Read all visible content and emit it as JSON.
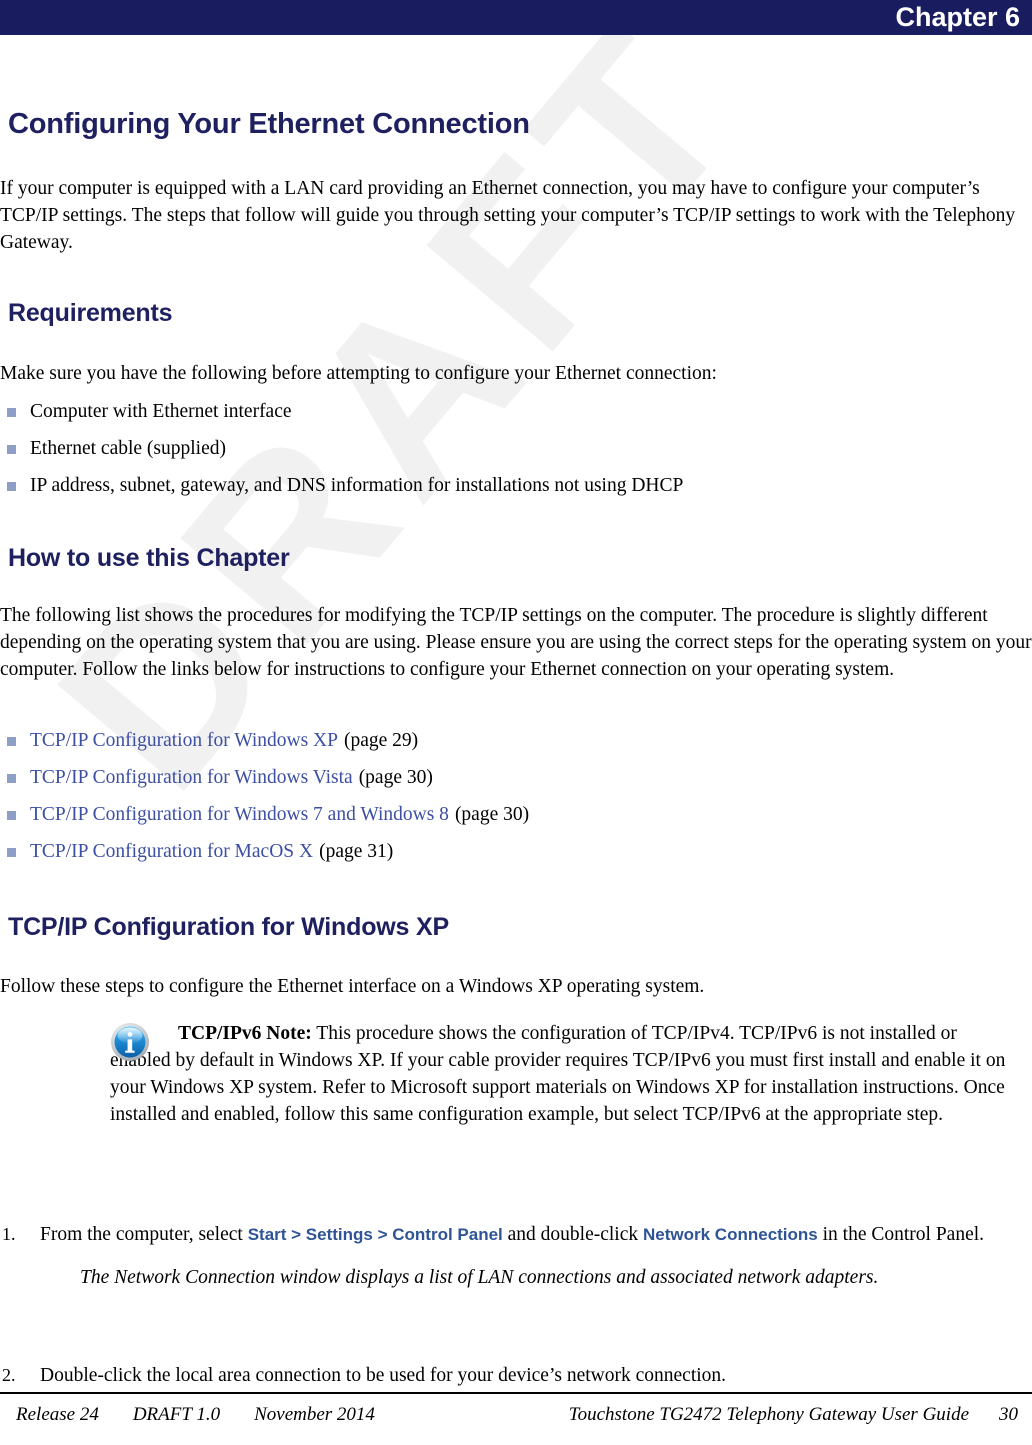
{
  "header": {
    "chapter_label": "Chapter 6",
    "bar_color": "#191c5e"
  },
  "watermark": {
    "text": "DRAFT",
    "color": "#f1f1f1"
  },
  "colors": {
    "heading": "#1e2060",
    "link": "#3c4fa3",
    "ui_object": "#2e5496",
    "bullet": "#8e9ec7"
  },
  "sections": {
    "main_heading": "Configuring Your Ethernet Connection",
    "intro_paragraph": "If your computer is equipped with a LAN card providing an Ethernet connection, you may have to configure your computer’s TCP/IP settings. The steps that follow will guide you through setting your computer’s TCP/IP settings to work with the Telephony Gateway.",
    "requirements": {
      "heading": "Requirements",
      "lead_in": "Make sure you have the following before attempting to configure your Ethernet connection:",
      "items": [
        "Computer with Ethernet interface",
        "Ethernet cable (supplied)",
        "IP address, subnet, gateway, and DNS information for installations not using DHCP"
      ]
    },
    "how_to_use": {
      "heading": "How to use this Chapter",
      "paragraph": "The following list shows the procedures for modifying the TCP/IP settings on the computer. The procedure is slightly different depending on the operating system that you are using. Please ensure you are using the correct steps for the operating system on your computer. Follow the links below for instructions to configure your Ethernet connection on your operating system.",
      "links": [
        {
          "label": "TCP/IP Configuration for Windows XP",
          "page_ref": "(page 29)"
        },
        {
          "label": "TCP/IP Configuration for Windows Vista",
          "page_ref": "(page 30)"
        },
        {
          "label": "TCP/IP Configuration for Windows 7 and Windows 8",
          "page_ref": "(page 30)"
        },
        {
          "label": "TCP/IP Configuration for MacOS X",
          "page_ref": "(page 31)"
        }
      ]
    },
    "winxp": {
      "heading": "TCP/IP Configuration for Windows XP",
      "intro": "Follow these steps to configure the Ethernet interface on a Windows XP operating system.",
      "note": {
        "icon": "info-icon",
        "lead": "TCP/IPv6 Note:",
        "body": " This procedure shows the configuration of TCP/IPv4.   TCP/IPv6 is not installed or enabled by default in Windows XP. If your cable provider requires TCP/IPv6 you must first install and enable it on your Windows XP system. Refer to Microsoft support materials on Windows XP for installation instructions. Once installed and enabled, follow this same configuration example, but select TCP/IPv6 at the appropriate step."
      },
      "steps": [
        {
          "number": "1.",
          "text_before": "From the computer, select ",
          "ui_object_1": "Start > Settings > Control Panel",
          "text_middle": " and double-click ",
          "ui_object_2": "Network Connections",
          "text_after": " in the Control Panel.",
          "result": "The Network Connection window displays a list of LAN connections and associated network adapters."
        },
        {
          "number": "2.",
          "text_full": "Double-click the local area connection to be used for your device’s network connection.",
          "result": ""
        }
      ]
    }
  },
  "footer": {
    "release": "Release 24",
    "draft_version": "DRAFT 1.0",
    "date": "November 2014",
    "guide_title": "Touchstone TG2472 Telephony Gateway User Guide",
    "page_number": "30"
  }
}
